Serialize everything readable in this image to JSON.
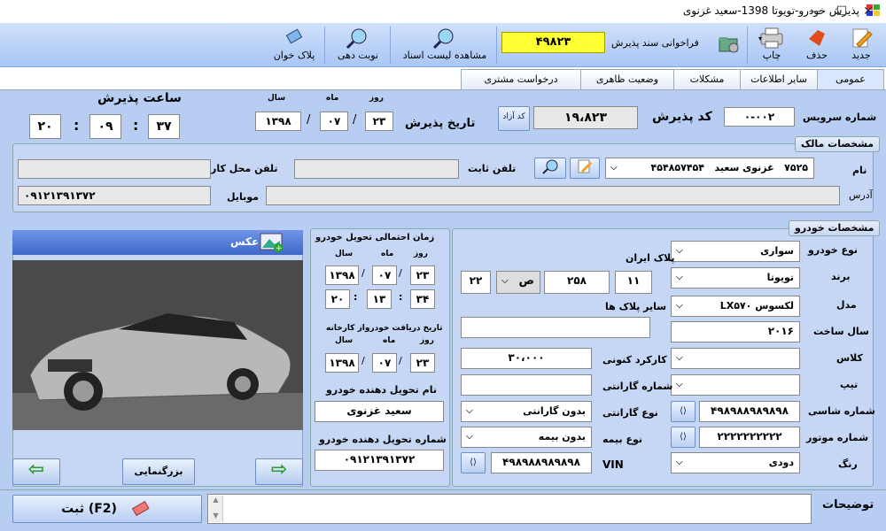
{
  "window": {
    "title": "پذیرش خودرو-تویوتا 1398-سعید غزنوی",
    "min": "—",
    "max": "☐",
    "close": "✕"
  },
  "toolbar": {
    "new": "جدید",
    "delete": "حذف",
    "print": "چاپ",
    "call_doc": "فراخوانی سند پذیرش",
    "doc_number": "۴۹۸۲۳",
    "view_list": "مشاهده لیست اسناد",
    "turn": "نوبت دهی",
    "plate_reader": "پلاک خوان"
  },
  "tabs": [
    "عمومی",
    "سایر اطلاعات",
    "مشکلات",
    "وضعیت ظاهری",
    "درخواست مشتری"
  ],
  "reception": {
    "service_no_label": "شماره سرویس",
    "service_no": "۰-۰۰۲",
    "code_label": "کد پذیرش",
    "code": "۱۹،۸۲۳",
    "free_code": "کد آزاد",
    "date_label": "تاریخ پذیرش",
    "day_label": "روز",
    "month_label": "ماه",
    "year_label": "سال",
    "day": "۲۳",
    "month": "۰۷",
    "year": "۱۳۹۸",
    "time_label": "ساعت پذیرش",
    "sec": "۳۷",
    "min": "۰۹",
    "hour": "۲۰"
  },
  "owner": {
    "title": "مشخصات مالک",
    "name_label": "نام",
    "code": "۷۵۲۵",
    "name": "غزنوی سعید",
    "national": "۴۵۴۸۵۷۴۵۴",
    "phone_label": "تلفن ثابت",
    "work_phone_label": "تلفن محل کار",
    "mobile_label": "موبایل",
    "mobile": "۰۹۱۲۱۳۹۱۳۷۲",
    "address_label": "آدرس"
  },
  "photo": {
    "label": "عکس",
    "zoom": "بزرگنمایی"
  },
  "delivery": {
    "title": "زمان احتمالی تحویل خودرو",
    "day_label": "روز",
    "month_label": "ماه",
    "year_label": "سال",
    "day": "۲۳",
    "month": "۰۷",
    "year": "۱۳۹۸",
    "m": "۳۴",
    "h": "۱۳",
    "s": "۲۰",
    "factory_label": "تاریخ دریافت خودرواز کارخانه",
    "f_day": "۲۳",
    "f_month": "۰۷",
    "f_year": "۱۳۹۸",
    "deliverer_label": "نام تحویل دهنده خودرو",
    "deliverer": "سعید غزنوی",
    "deliverer_phone_label": "شماره تحویل دهنده خودرو",
    "deliverer_phone": "۰۹۱۲۱۳۹۱۳۷۲"
  },
  "vehicle": {
    "title": "مشخصات خودرو",
    "type_label": "نوع خودرو",
    "type": "سواری",
    "brand_label": "برند",
    "brand": "تویوتا",
    "model_label": "مدل",
    "model": "لکسوس LX۵۷۰",
    "year_label": "سال ساخت",
    "year": "۲۰۱۶",
    "class_label": "کلاس",
    "tip_label": "تیپ",
    "chassis_label": "شماره شاسی",
    "chassis": "۴۹۸۹۸۸۹۸۹۸۹۸",
    "engine_label": "شماره موتور",
    "engine": "۲۲۲۲۲۲۲۲۲۲",
    "color_label": "رنگ",
    "color": "دودی",
    "plate_label": "پلاک ایران",
    "plate_a": "۱۱",
    "plate_b": "۲۵۸",
    "plate_letter": "ص",
    "plate_c": "۲۲",
    "other_plates_label": "سایر پلاک ها",
    "mileage_label": "کارکرد کنونی",
    "mileage": "۳۰،۰۰۰",
    "warranty_no_label": "شماره گارانتی",
    "warranty_type_label": "نوع گارانتی",
    "warranty_type": "بدون گارانتی",
    "insurance_label": "نوع بیمه",
    "insurance": "بدون بیمه",
    "vin_label": "VIN",
    "vin": "۴۹۸۹۸۸۹۸۹۸۹۸"
  },
  "footer": {
    "notes_label": "توضیحات",
    "save": "ثبت (F2)"
  }
}
